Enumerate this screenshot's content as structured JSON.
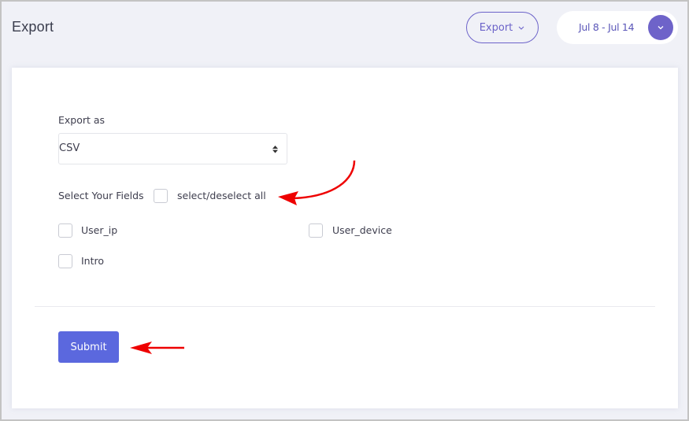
{
  "header": {
    "title": "Export",
    "export_menu_label": "Export",
    "date_range": "Jul 8 - Jul 14"
  },
  "form": {
    "export_as_label": "Export as",
    "export_as_value": "CSV",
    "select_fields_label": "Select Your Fields",
    "select_all_label": "select/deselect all",
    "fields": [
      {
        "label": "User_ip",
        "checked": false
      },
      {
        "label": "User_device",
        "checked": false
      },
      {
        "label": "Intro",
        "checked": false
      }
    ],
    "submit_label": "Submit"
  },
  "colors": {
    "accent": "#6c63c9",
    "submit": "#5b68de",
    "annotation_arrow": "#ee0000",
    "background": "#f0f1f7"
  }
}
